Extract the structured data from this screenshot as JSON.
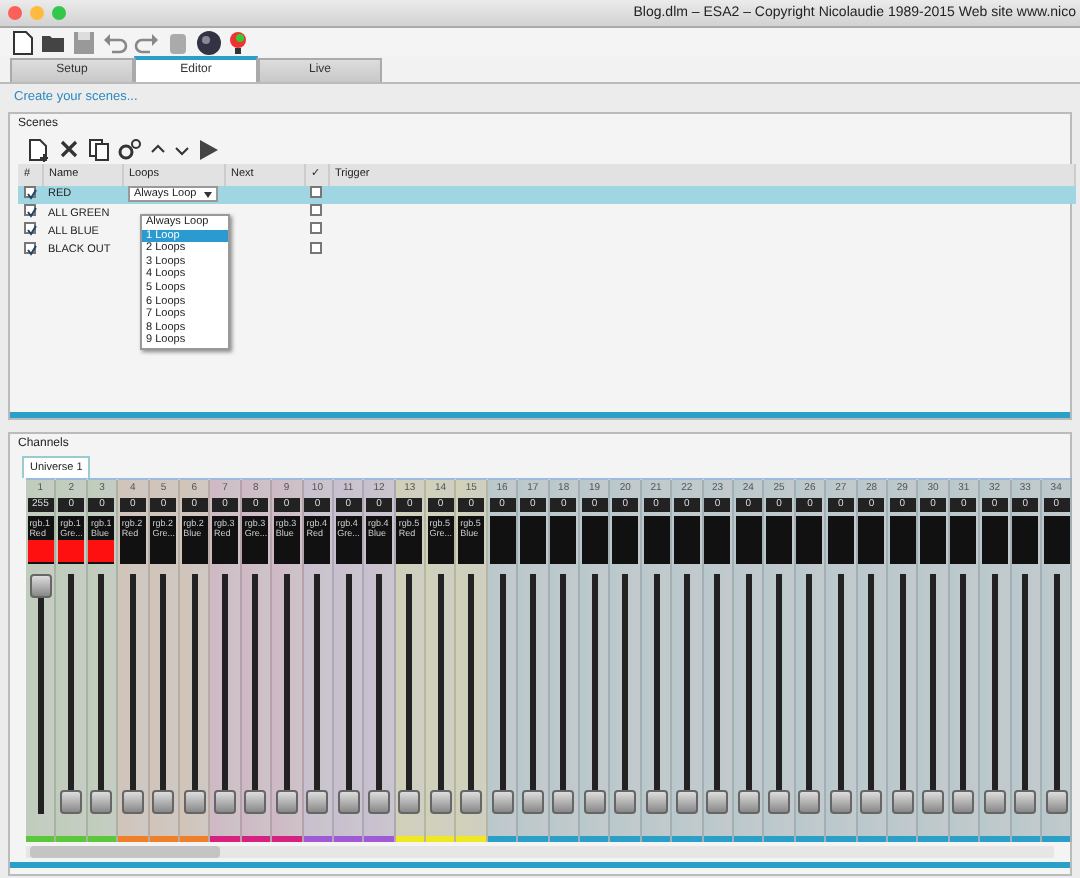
{
  "window": {
    "title": "Blog.dlm – ESA2 – Copyright Nicolaudie 1989-2015 Web site www.nico"
  },
  "tabs": [
    {
      "label": "Setup",
      "selected": false
    },
    {
      "label": "Editor",
      "selected": true
    },
    {
      "label": "Live",
      "selected": false
    }
  ],
  "create_link": "Create your scenes...",
  "scenes": {
    "title": "Scenes",
    "columns": [
      "#",
      "Name",
      "Loops",
      "Next",
      "✓",
      "Trigger"
    ],
    "rows": [
      {
        "enabled": true,
        "name": "RED",
        "loops": "Always Loop",
        "flag": false,
        "selected": true
      },
      {
        "enabled": true,
        "name": "ALL GREEN",
        "flag": false,
        "selected": false
      },
      {
        "enabled": true,
        "name": "ALL BLUE",
        "flag": false,
        "selected": false
      },
      {
        "enabled": true,
        "name": "BLACK OUT",
        "flag": false,
        "selected": false
      }
    ],
    "dropdown_options": [
      {
        "label": "Always Loop",
        "selected": false
      },
      {
        "label": "1 Loop",
        "selected": true
      },
      {
        "label": "2 Loops",
        "selected": false
      },
      {
        "label": "3 Loops",
        "selected": false
      },
      {
        "label": "4 Loops",
        "selected": false
      },
      {
        "label": "5 Loops",
        "selected": false
      },
      {
        "label": "6 Loops",
        "selected": false
      },
      {
        "label": "7 Loops",
        "selected": false
      },
      {
        "label": "8 Loops",
        "selected": false
      },
      {
        "label": "9 Loops",
        "selected": false
      }
    ]
  },
  "channels": {
    "title": "Channels",
    "universe_tab": "Universe 1",
    "items": [
      {
        "number": "1",
        "value": "255",
        "label": "rgb.1",
        "sublabel": "Red",
        "lit": true,
        "color": "#5ac83a",
        "level": 1
      },
      {
        "number": "2",
        "value": "0",
        "label": "rgb.1",
        "sublabel": "Gre...",
        "lit": true,
        "color": "#5ac83a",
        "level": 0
      },
      {
        "number": "3",
        "value": "0",
        "label": "rgb.1",
        "sublabel": "Blue",
        "lit": true,
        "color": "#5ac83a",
        "level": 0
      },
      {
        "number": "4",
        "value": "0",
        "label": "rgb.2",
        "sublabel": "Red",
        "color": "#f07f2a",
        "level": 0
      },
      {
        "number": "5",
        "value": "0",
        "label": "rgb.2",
        "sublabel": "Gre...",
        "color": "#f07f2a",
        "level": 0
      },
      {
        "number": "6",
        "value": "0",
        "label": "rgb.2",
        "sublabel": "Blue",
        "color": "#f07f2a",
        "level": 0
      },
      {
        "number": "7",
        "value": "0",
        "label": "rgb.3",
        "sublabel": "Red",
        "color": "#d6217e",
        "level": 0
      },
      {
        "number": "8",
        "value": "0",
        "label": "rgb.3",
        "sublabel": "Gre...",
        "color": "#d6217e",
        "level": 0
      },
      {
        "number": "9",
        "value": "0",
        "label": "rgb.3",
        "sublabel": "Blue",
        "color": "#d6217e",
        "level": 0
      },
      {
        "number": "10",
        "value": "0",
        "label": "rgb.4",
        "sublabel": "Red",
        "color": "#a05ad8",
        "level": 0
      },
      {
        "number": "11",
        "value": "0",
        "label": "rgb.4",
        "sublabel": "Gre...",
        "color": "#a05ad8",
        "level": 0
      },
      {
        "number": "12",
        "value": "0",
        "label": "rgb.4",
        "sublabel": "Blue",
        "color": "#a05ad8",
        "level": 0
      },
      {
        "number": "13",
        "value": "0",
        "label": "rgb.5",
        "sublabel": "Red",
        "color": "#f0e820",
        "level": 0
      },
      {
        "number": "14",
        "value": "0",
        "label": "rgb.5",
        "sublabel": "Gre...",
        "color": "#f0e820",
        "level": 0
      },
      {
        "number": "15",
        "value": "0",
        "label": "rgb.5",
        "sublabel": "Blue",
        "color": "#f0e820",
        "level": 0
      },
      {
        "number": "16",
        "value": "0",
        "color": "#2aa0c8",
        "level": 0
      },
      {
        "number": "17",
        "value": "0",
        "color": "#2aa0c8",
        "level": 0
      },
      {
        "number": "18",
        "value": "0",
        "color": "#2aa0c8",
        "level": 0
      },
      {
        "number": "19",
        "value": "0",
        "color": "#2aa0c8",
        "level": 0
      },
      {
        "number": "20",
        "value": "0",
        "color": "#2aa0c8",
        "level": 0
      },
      {
        "number": "21",
        "value": "0",
        "color": "#2aa0c8",
        "level": 0
      },
      {
        "number": "22",
        "value": "0",
        "color": "#2aa0c8",
        "level": 0
      },
      {
        "number": "23",
        "value": "0",
        "color": "#2aa0c8",
        "level": 0
      },
      {
        "number": "24",
        "value": "0",
        "color": "#2aa0c8",
        "level": 0
      },
      {
        "number": "25",
        "value": "0",
        "color": "#2aa0c8",
        "level": 0
      },
      {
        "number": "26",
        "value": "0",
        "color": "#2aa0c8",
        "level": 0
      },
      {
        "number": "27",
        "value": "0",
        "color": "#2aa0c8",
        "level": 0
      },
      {
        "number": "28",
        "value": "0",
        "color": "#2aa0c8",
        "level": 0
      },
      {
        "number": "29",
        "value": "0",
        "color": "#2aa0c8",
        "level": 0
      },
      {
        "number": "30",
        "value": "0",
        "color": "#2aa0c8",
        "level": 0
      },
      {
        "number": "31",
        "value": "0",
        "color": "#2aa0c8",
        "level": 0
      },
      {
        "number": "32",
        "value": "0",
        "color": "#2aa0c8",
        "level": 0
      },
      {
        "number": "33",
        "value": "0",
        "color": "#2aa0c8",
        "level": 0
      },
      {
        "number": "34",
        "value": "0",
        "color": "#2aa0c8",
        "level": 0
      }
    ]
  }
}
